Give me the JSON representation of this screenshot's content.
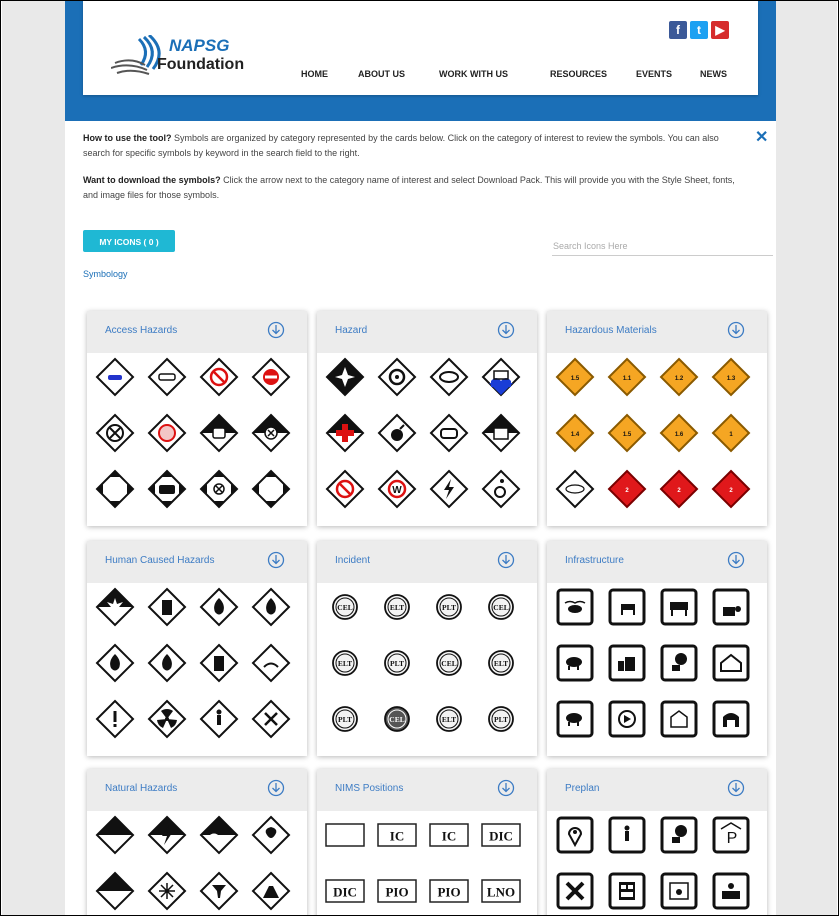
{
  "header": {
    "logo_line1": "NAPSG",
    "logo_line2": "Foundation",
    "nav": [
      {
        "label": "HOME",
        "name": "nav-home"
      },
      {
        "label": "ABOUT US",
        "name": "nav-about-us"
      },
      {
        "label": "WORK WITH US",
        "name": "nav-work-with-us"
      },
      {
        "label": "RESOURCES",
        "name": "nav-resources"
      },
      {
        "label": "EVENTS",
        "name": "nav-events"
      },
      {
        "label": "NEWS",
        "name": "nav-news"
      }
    ],
    "social": [
      {
        "name": "facebook-icon",
        "glyph": "f",
        "color": "#3b5998"
      },
      {
        "name": "twitter-icon",
        "glyph": "t",
        "color": "#1da1f2"
      },
      {
        "name": "youtube-icon",
        "glyph": "▶",
        "color": "#d62b2b"
      }
    ]
  },
  "intro": {
    "q1_bold": "How to use the tool?",
    "q1_text": " Symbols are organized by category represented by the cards below. Click on the category of interest to review the symbols. You can also search for specific symbols by keyword in the search field to the right.",
    "q2_bold": "Want to download the symbols?",
    "q2_text": " Click the arrow next to the category name of interest and select Download Pack. This will provide you with the Style Sheet, fonts, and image files for those symbols.",
    "close_glyph": "✕"
  },
  "toolbar": {
    "my_icons_label": "MY ICONS ( 0 )",
    "search_placeholder": "Search Icons Here",
    "breadcrumb": "Symbology"
  },
  "colors": {
    "accent": "#1b6fb7",
    "button": "#1fb8d4",
    "card_title": "#3d7cc4",
    "hazmat_orange": "#f5a623",
    "hazmat_red": "#e0181b"
  },
  "cards": [
    {
      "title": "Access Hazards",
      "icons": [
        {
          "name": "access-car-icon",
          "kind": "diamond",
          "glyph": "car"
        },
        {
          "name": "access-vehicle-icon",
          "kind": "diamond",
          "glyph": "car2"
        },
        {
          "name": "access-no-vehicle-icon",
          "kind": "diamond",
          "glyph": "nocar"
        },
        {
          "name": "access-no-entry-icon",
          "kind": "diamond",
          "glyph": "noentry"
        },
        {
          "name": "access-blocked-icon",
          "kind": "diamond",
          "glyph": "xcircle"
        },
        {
          "name": "access-restricted-icon",
          "kind": "diamond",
          "glyph": "nocar2"
        },
        {
          "name": "access-vehicle-front-icon",
          "kind": "diamond-split",
          "glyph": "carfront"
        },
        {
          "name": "access-closed-icon",
          "kind": "diamond-split",
          "glyph": "xcircle2"
        },
        {
          "name": "access-open-icon",
          "kind": "diamond-corners",
          "glyph": ""
        },
        {
          "name": "access-bus-icon",
          "kind": "diamond-corners",
          "glyph": "bus"
        },
        {
          "name": "access-point-icon",
          "kind": "diamond-corners",
          "glyph": "xsmall"
        },
        {
          "name": "access-gate-icon",
          "kind": "diamond-corners",
          "glyph": ""
        }
      ]
    },
    {
      "title": "Hazard",
      "icons": [
        {
          "name": "hazard-aircraft-icon",
          "kind": "diamond-black",
          "glyph": "plane"
        },
        {
          "name": "hazard-biological-icon",
          "kind": "diamond",
          "glyph": "bio"
        },
        {
          "name": "hazard-drugs-icon",
          "kind": "diamond",
          "glyph": "drugs"
        },
        {
          "name": "hazard-flood-icon",
          "kind": "diamond-blue",
          "glyph": "flood"
        },
        {
          "name": "hazard-medical-icon",
          "kind": "diamond-split",
          "glyph": "cross"
        },
        {
          "name": "hazard-explosive-icon",
          "kind": "diamond",
          "glyph": "bomb"
        },
        {
          "name": "hazard-gas-icon",
          "kind": "diamond",
          "glyph": "tank"
        },
        {
          "name": "hazard-electric-icon",
          "kind": "diamond-split",
          "glyph": "box"
        },
        {
          "name": "hazard-no-fire-icon",
          "kind": "diamond",
          "glyph": "nofire"
        },
        {
          "name": "hazard-weather-icon",
          "kind": "diamond",
          "glyph": "W"
        },
        {
          "name": "hazard-lightning-icon",
          "kind": "diamond",
          "glyph": "bolt"
        },
        {
          "name": "hazard-accessibility-icon",
          "kind": "diamond",
          "glyph": "wheel"
        }
      ]
    },
    {
      "title": "Hazardous Materials",
      "icons": [
        {
          "name": "hazmat-blasting-agents-icon",
          "kind": "diamond-orange",
          "glyph": "1.5"
        },
        {
          "name": "hazmat-explosives-11-icon",
          "kind": "diamond-orange",
          "glyph": "1.1"
        },
        {
          "name": "hazmat-explosives-12-icon",
          "kind": "diamond-orange",
          "glyph": "1.2"
        },
        {
          "name": "hazmat-explosives-13-icon",
          "kind": "diamond-orange",
          "glyph": "1.3"
        },
        {
          "name": "hazmat-explosives-14-icon",
          "kind": "diamond-orange",
          "glyph": "1.4"
        },
        {
          "name": "hazmat-explosives-15-icon",
          "kind": "diamond-orange",
          "glyph": "1.5"
        },
        {
          "name": "hazmat-explosives-16-icon",
          "kind": "diamond-orange",
          "glyph": "1.6"
        },
        {
          "name": "hazmat-explosives-17-icon",
          "kind": "diamond-orange",
          "glyph": "1"
        },
        {
          "name": "hazmat-chlorine-icon",
          "kind": "diamond",
          "glyph": "cl"
        },
        {
          "name": "hazmat-flammable-gas-icon",
          "kind": "diamond-red",
          "glyph": "2"
        },
        {
          "name": "hazmat-flammable-solid-icon",
          "kind": "diamond-red",
          "glyph": "2"
        },
        {
          "name": "hazmat-flammable-liquid-icon",
          "kind": "diamond-red",
          "glyph": "2"
        }
      ]
    },
    {
      "title": "Human Caused Hazards",
      "icons": [
        {
          "name": "human-explosion-icon",
          "kind": "diamond-split",
          "glyph": "burst"
        },
        {
          "name": "human-building-fire-icon",
          "kind": "diamond",
          "glyph": "building"
        },
        {
          "name": "human-fire-icon",
          "kind": "diamond",
          "glyph": "flame"
        },
        {
          "name": "human-vehicle-fire-icon",
          "kind": "diamond",
          "glyph": "flame"
        },
        {
          "name": "human-fire2-icon",
          "kind": "diamond",
          "glyph": "flame"
        },
        {
          "name": "human-burst-icon",
          "kind": "diamond",
          "glyph": "flame"
        },
        {
          "name": "human-structure-fire-icon",
          "kind": "diamond",
          "glyph": "building"
        },
        {
          "name": "human-spill-icon",
          "kind": "diamond",
          "glyph": "spill"
        },
        {
          "name": "human-warning-icon",
          "kind": "diamond",
          "glyph": "!"
        },
        {
          "name": "human-radiological-icon",
          "kind": "diamond",
          "glyph": "rad"
        },
        {
          "name": "human-person-icon",
          "kind": "diamond",
          "glyph": "person"
        },
        {
          "name": "human-sabotage-icon",
          "kind": "diamond",
          "glyph": "tools"
        }
      ]
    },
    {
      "title": "Incident",
      "icons": [
        {
          "name": "incident-cel-icon",
          "kind": "circle",
          "glyph": "CEL"
        },
        {
          "name": "incident-elt-icon",
          "kind": "circle",
          "glyph": "ELT"
        },
        {
          "name": "incident-plt-icon",
          "kind": "circle",
          "glyph": "PLT"
        },
        {
          "name": "incident-cel2-icon",
          "kind": "circle",
          "glyph": "CEL"
        },
        {
          "name": "incident-elt2-icon",
          "kind": "circle",
          "glyph": "ELT"
        },
        {
          "name": "incident-plt2-icon",
          "kind": "circle",
          "glyph": "PLT"
        },
        {
          "name": "incident-cel3-icon",
          "kind": "circle",
          "glyph": "CEL"
        },
        {
          "name": "incident-elt3-icon",
          "kind": "circle",
          "glyph": "ELT"
        },
        {
          "name": "incident-plt3-icon",
          "kind": "circle",
          "glyph": "PLT"
        },
        {
          "name": "incident-cel4-icon",
          "kind": "circle-dark",
          "glyph": "CEL"
        },
        {
          "name": "incident-elt4-icon",
          "kind": "circle",
          "glyph": "ELT"
        },
        {
          "name": "incident-plt4-icon",
          "kind": "circle",
          "glyph": "PLT"
        }
      ]
    },
    {
      "title": "Infrastructure",
      "icons": [
        {
          "name": "infra-fish-icon",
          "kind": "square",
          "glyph": "fish"
        },
        {
          "name": "infra-livestock-icon",
          "kind": "square",
          "glyph": "animal"
        },
        {
          "name": "infra-cattle-icon",
          "kind": "square",
          "glyph": "cow"
        },
        {
          "name": "infra-plant-icon",
          "kind": "square",
          "glyph": "plant"
        },
        {
          "name": "infra-pig-icon",
          "kind": "square",
          "glyph": "pig"
        },
        {
          "name": "infra-farm-icon",
          "kind": "square",
          "glyph": "barn"
        },
        {
          "name": "infra-orchard-icon",
          "kind": "square",
          "glyph": "tree"
        },
        {
          "name": "infra-greenhouse-icon",
          "kind": "square",
          "glyph": "house"
        },
        {
          "name": "infra-swine-icon",
          "kind": "square",
          "glyph": "pig"
        },
        {
          "name": "infra-poultry-icon",
          "kind": "square",
          "glyph": "circle"
        },
        {
          "name": "infra-silo-icon",
          "kind": "square",
          "glyph": "barn2"
        },
        {
          "name": "infra-shelter-icon",
          "kind": "square",
          "glyph": "arch"
        }
      ]
    },
    {
      "title": "Natural Hazards",
      "icons": [
        {
          "name": "natural-landslide-icon",
          "kind": "diamond-split",
          "glyph": ""
        },
        {
          "name": "natural-lightning-icon",
          "kind": "diamond-split",
          "glyph": "bolt"
        },
        {
          "name": "natural-flood-icon",
          "kind": "diamond-split",
          "glyph": "wave"
        },
        {
          "name": "natural-hurricane-icon",
          "kind": "diamond",
          "glyph": "storm"
        },
        {
          "name": "natural-avalanche-icon",
          "kind": "diamond-split",
          "glyph": ""
        },
        {
          "name": "natural-snow-icon",
          "kind": "diamond",
          "glyph": "snow"
        },
        {
          "name": "natural-tornado-icon",
          "kind": "diamond",
          "glyph": "tornado"
        },
        {
          "name": "natural-volcano-icon",
          "kind": "diamond",
          "glyph": "volcano"
        }
      ]
    },
    {
      "title": "NIMS Positions",
      "icons": [
        {
          "name": "nims-blank-icon",
          "kind": "rect",
          "glyph": ""
        },
        {
          "name": "nims-ic-icon",
          "kind": "rect",
          "glyph": "IC"
        },
        {
          "name": "nims-ic2-icon",
          "kind": "rect",
          "glyph": "IC"
        },
        {
          "name": "nims-dic-icon",
          "kind": "rect",
          "glyph": "DIC"
        },
        {
          "name": "nims-dic2-icon",
          "kind": "rect",
          "glyph": "DIC"
        },
        {
          "name": "nims-pio-icon",
          "kind": "rect",
          "glyph": "PIO"
        },
        {
          "name": "nims-pio2-icon",
          "kind": "rect",
          "glyph": "PIO"
        },
        {
          "name": "nims-lno-icon",
          "kind": "rect",
          "glyph": "LNO"
        }
      ]
    },
    {
      "title": "Preplan",
      "icons": [
        {
          "name": "preplan-location-icon",
          "kind": "square",
          "glyph": "pin"
        },
        {
          "name": "preplan-shelter-icon",
          "kind": "square",
          "glyph": "person"
        },
        {
          "name": "preplan-picnic-icon",
          "kind": "square",
          "glyph": "tree"
        },
        {
          "name": "preplan-parking-icon",
          "kind": "square",
          "glyph": "P"
        },
        {
          "name": "preplan-tools-icon",
          "kind": "square",
          "glyph": "X"
        },
        {
          "name": "preplan-panel-icon",
          "kind": "square",
          "glyph": "panel"
        },
        {
          "name": "preplan-settings-icon",
          "kind": "square",
          "glyph": "gear"
        },
        {
          "name": "preplan-desk-icon",
          "kind": "square",
          "glyph": "desk"
        }
      ]
    }
  ]
}
